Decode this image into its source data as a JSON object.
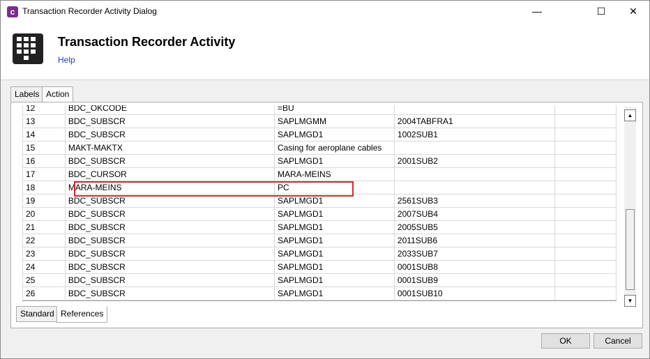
{
  "window": {
    "title": "Transaction Recorder Activity Dialog",
    "app_icon_letter": "c",
    "minimize_glyph": "—",
    "maximize_glyph": "☐",
    "close_glyph": "✕"
  },
  "header": {
    "title": "Transaction Recorder Activity",
    "help_label": "Help",
    "icon": "keypad-icon"
  },
  "tabs_top": [
    {
      "label": "Labels",
      "active": false
    },
    {
      "label": "Action",
      "active": true
    }
  ],
  "grid": {
    "partial_row": {
      "num": "12",
      "field": "BDC_OKCODE",
      "value": "=BU",
      "extra": ""
    },
    "rows": [
      {
        "num": "13",
        "field": "BDC_SUBSCR",
        "value": "SAPLMGMM",
        "extra": "2004TABFRA1"
      },
      {
        "num": "14",
        "field": "BDC_SUBSCR",
        "value": "SAPLMGD1",
        "extra": "1002SUB1"
      },
      {
        "num": "15",
        "field": "MAKT-MAKTX",
        "value": "Casing for aeroplane cables",
        "extra": ""
      },
      {
        "num": "16",
        "field": "BDC_SUBSCR",
        "value": "SAPLMGD1",
        "extra": "2001SUB2"
      },
      {
        "num": "17",
        "field": "BDC_CURSOR",
        "value": "MARA-MEINS",
        "extra": ""
      },
      {
        "num": "18",
        "field": "MARA-MEINS",
        "value": "PC",
        "extra": ""
      },
      {
        "num": "19",
        "field": "BDC_SUBSCR",
        "value": "SAPLMGD1",
        "extra": "2561SUB3"
      },
      {
        "num": "20",
        "field": "BDC_SUBSCR",
        "value": "SAPLMGD1",
        "extra": "2007SUB4"
      },
      {
        "num": "21",
        "field": "BDC_SUBSCR",
        "value": "SAPLMGD1",
        "extra": "2005SUB5"
      },
      {
        "num": "22",
        "field": "BDC_SUBSCR",
        "value": "SAPLMGD1",
        "extra": "2011SUB6"
      },
      {
        "num": "23",
        "field": "BDC_SUBSCR",
        "value": "SAPLMGD1",
        "extra": "2033SUB7"
      },
      {
        "num": "24",
        "field": "BDC_SUBSCR",
        "value": "SAPLMGD1",
        "extra": "0001SUB8"
      },
      {
        "num": "25",
        "field": "BDC_SUBSCR",
        "value": "SAPLMGD1",
        "extra": "0001SUB9"
      },
      {
        "num": "26",
        "field": "BDC_SUBSCR",
        "value": "SAPLMGD1",
        "extra": "0001SUB10"
      }
    ],
    "highlight_color": "#d9272e"
  },
  "scrollbar": {
    "up_glyph": "▲",
    "down_glyph": "▼"
  },
  "tabs_bottom": [
    {
      "label": "Standard",
      "active": false
    },
    {
      "label": "References",
      "active": true
    }
  ],
  "buttons": {
    "ok_label": "OK",
    "cancel_label": "Cancel"
  }
}
